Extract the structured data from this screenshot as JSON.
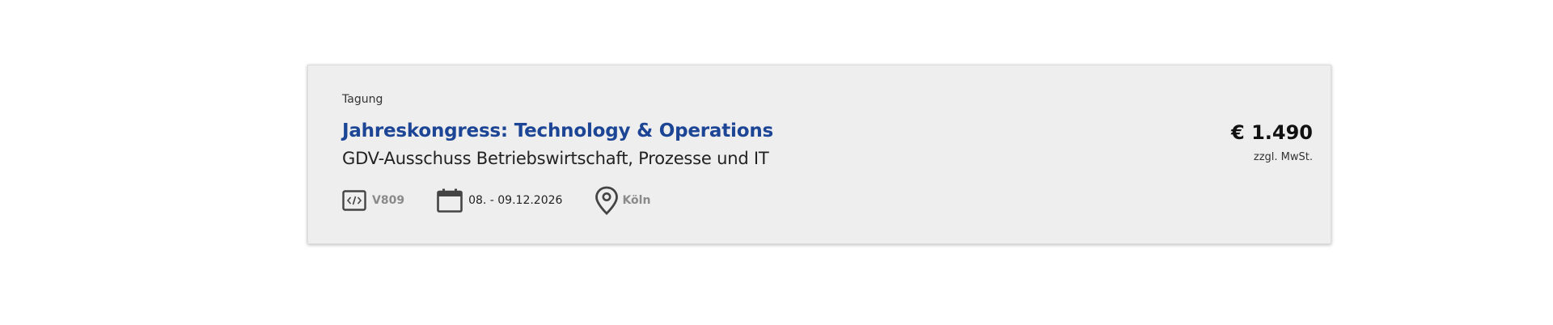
{
  "event": {
    "category": "Tagung",
    "title": "Jahreskongress: Technology & Operations",
    "subtitle": "GDV-Ausschuss Betriebswirtschaft, Prozesse und IT",
    "code": "V809",
    "date": "08. - 09.12.2026",
    "location": "Köln",
    "price": "€ 1.490",
    "price_note": "zzgl. MwSt."
  },
  "icons": {
    "code": "code-icon",
    "date": "calendar-icon",
    "location": "location-pin-icon"
  },
  "colors": {
    "title": "#1c4595",
    "card_background": "#eeeeee",
    "icon": "#444444"
  }
}
